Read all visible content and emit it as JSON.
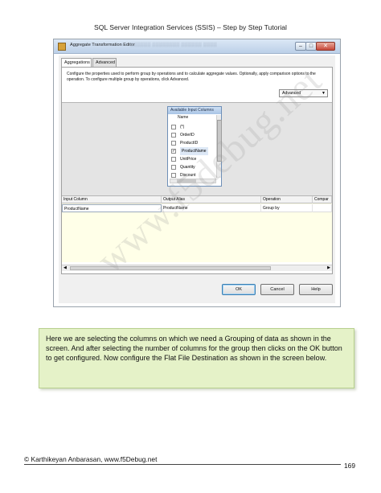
{
  "header": {
    "text": "SQL Server Integration Services (SSIS) – Step by Step Tutorial"
  },
  "window": {
    "title": "Aggregate Transformation Editor",
    "tabs": [
      {
        "label": "Aggregations"
      },
      {
        "label": "Advanced"
      }
    ],
    "description": "Configure the properties used to perform group by operations and to calculate aggregate values. Optionally, apply comparison options to the operation. To configure multiple group by operations, click Advanced.",
    "mode_combo": {
      "value": "Advanced"
    },
    "available_columns": {
      "title": "Available Input Columns",
      "header": "Name",
      "rows": [
        {
          "label": "(*)",
          "checked": false
        },
        {
          "label": "OrderID",
          "checked": false
        },
        {
          "label": "ProductID",
          "checked": false
        },
        {
          "label": "ProductName",
          "checked": true
        },
        {
          "label": "UnitPrice",
          "checked": false
        },
        {
          "label": "Quantity",
          "checked": false
        },
        {
          "label": "Discount",
          "checked": false
        }
      ]
    },
    "grid": {
      "columns": [
        "Input Column",
        "Output Alias",
        "Operation",
        "Compar"
      ],
      "rows": [
        [
          "ProductName",
          "ProductName",
          "Group by",
          ""
        ]
      ]
    },
    "buttons": {
      "ok": "OK",
      "cancel": "Cancel",
      "help": "Help"
    }
  },
  "note": {
    "text": "Here we are selecting the columns on which we need a Grouping of data as shown in the screen. And after selecting the number of columns for the group then clicks on the OK button to get configured. Now configure the Flat File Destination as shown in the screen below."
  },
  "watermark": {
    "text": "www.f5debug.net"
  },
  "footer": {
    "left": "© Karthikeyan Anbarasan, www.f5Debug.net",
    "page": "169"
  }
}
